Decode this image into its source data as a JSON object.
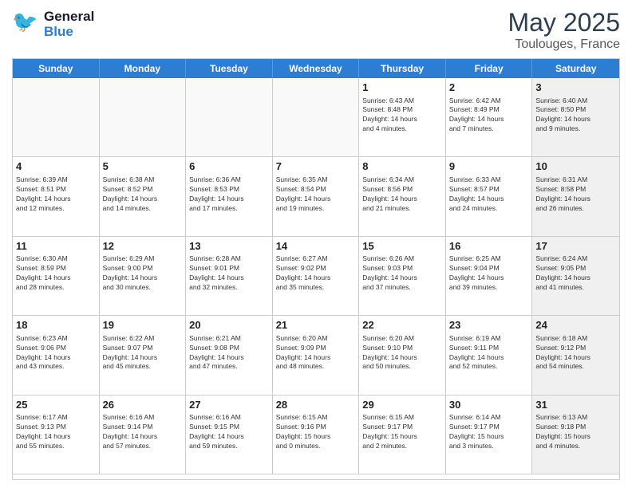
{
  "header": {
    "logo_general": "General",
    "logo_blue": "Blue",
    "month_title": "May 2025",
    "location": "Toulouges, France"
  },
  "day_headers": [
    "Sunday",
    "Monday",
    "Tuesday",
    "Wednesday",
    "Thursday",
    "Friday",
    "Saturday"
  ],
  "cells": [
    {
      "day": "",
      "empty": true
    },
    {
      "day": "",
      "empty": true
    },
    {
      "day": "",
      "empty": true
    },
    {
      "day": "",
      "empty": true
    },
    {
      "day": "1",
      "info": "Sunrise: 6:43 AM\nSunset: 8:48 PM\nDaylight: 14 hours\nand 4 minutes."
    },
    {
      "day": "2",
      "info": "Sunrise: 6:42 AM\nSunset: 8:49 PM\nDaylight: 14 hours\nand 7 minutes."
    },
    {
      "day": "3",
      "info": "Sunrise: 6:40 AM\nSunset: 8:50 PM\nDaylight: 14 hours\nand 9 minutes.",
      "shaded": true
    },
    {
      "day": "4",
      "info": "Sunrise: 6:39 AM\nSunset: 8:51 PM\nDaylight: 14 hours\nand 12 minutes."
    },
    {
      "day": "5",
      "info": "Sunrise: 6:38 AM\nSunset: 8:52 PM\nDaylight: 14 hours\nand 14 minutes."
    },
    {
      "day": "6",
      "info": "Sunrise: 6:36 AM\nSunset: 8:53 PM\nDaylight: 14 hours\nand 17 minutes."
    },
    {
      "day": "7",
      "info": "Sunrise: 6:35 AM\nSunset: 8:54 PM\nDaylight: 14 hours\nand 19 minutes."
    },
    {
      "day": "8",
      "info": "Sunrise: 6:34 AM\nSunset: 8:56 PM\nDaylight: 14 hours\nand 21 minutes."
    },
    {
      "day": "9",
      "info": "Sunrise: 6:33 AM\nSunset: 8:57 PM\nDaylight: 14 hours\nand 24 minutes."
    },
    {
      "day": "10",
      "info": "Sunrise: 6:31 AM\nSunset: 8:58 PM\nDaylight: 14 hours\nand 26 minutes.",
      "shaded": true
    },
    {
      "day": "11",
      "info": "Sunrise: 6:30 AM\nSunset: 8:59 PM\nDaylight: 14 hours\nand 28 minutes."
    },
    {
      "day": "12",
      "info": "Sunrise: 6:29 AM\nSunset: 9:00 PM\nDaylight: 14 hours\nand 30 minutes."
    },
    {
      "day": "13",
      "info": "Sunrise: 6:28 AM\nSunset: 9:01 PM\nDaylight: 14 hours\nand 32 minutes."
    },
    {
      "day": "14",
      "info": "Sunrise: 6:27 AM\nSunset: 9:02 PM\nDaylight: 14 hours\nand 35 minutes."
    },
    {
      "day": "15",
      "info": "Sunrise: 6:26 AM\nSunset: 9:03 PM\nDaylight: 14 hours\nand 37 minutes."
    },
    {
      "day": "16",
      "info": "Sunrise: 6:25 AM\nSunset: 9:04 PM\nDaylight: 14 hours\nand 39 minutes."
    },
    {
      "day": "17",
      "info": "Sunrise: 6:24 AM\nSunset: 9:05 PM\nDaylight: 14 hours\nand 41 minutes.",
      "shaded": true
    },
    {
      "day": "18",
      "info": "Sunrise: 6:23 AM\nSunset: 9:06 PM\nDaylight: 14 hours\nand 43 minutes."
    },
    {
      "day": "19",
      "info": "Sunrise: 6:22 AM\nSunset: 9:07 PM\nDaylight: 14 hours\nand 45 minutes."
    },
    {
      "day": "20",
      "info": "Sunrise: 6:21 AM\nSunset: 9:08 PM\nDaylight: 14 hours\nand 47 minutes."
    },
    {
      "day": "21",
      "info": "Sunrise: 6:20 AM\nSunset: 9:09 PM\nDaylight: 14 hours\nand 48 minutes."
    },
    {
      "day": "22",
      "info": "Sunrise: 6:20 AM\nSunset: 9:10 PM\nDaylight: 14 hours\nand 50 minutes."
    },
    {
      "day": "23",
      "info": "Sunrise: 6:19 AM\nSunset: 9:11 PM\nDaylight: 14 hours\nand 52 minutes."
    },
    {
      "day": "24",
      "info": "Sunrise: 6:18 AM\nSunset: 9:12 PM\nDaylight: 14 hours\nand 54 minutes.",
      "shaded": true
    },
    {
      "day": "25",
      "info": "Sunrise: 6:17 AM\nSunset: 9:13 PM\nDaylight: 14 hours\nand 55 minutes."
    },
    {
      "day": "26",
      "info": "Sunrise: 6:16 AM\nSunset: 9:14 PM\nDaylight: 14 hours\nand 57 minutes."
    },
    {
      "day": "27",
      "info": "Sunrise: 6:16 AM\nSunset: 9:15 PM\nDaylight: 14 hours\nand 59 minutes."
    },
    {
      "day": "28",
      "info": "Sunrise: 6:15 AM\nSunset: 9:16 PM\nDaylight: 15 hours\nand 0 minutes."
    },
    {
      "day": "29",
      "info": "Sunrise: 6:15 AM\nSunset: 9:17 PM\nDaylight: 15 hours\nand 2 minutes."
    },
    {
      "day": "30",
      "info": "Sunrise: 6:14 AM\nSunset: 9:17 PM\nDaylight: 15 hours\nand 3 minutes."
    },
    {
      "day": "31",
      "info": "Sunrise: 6:13 AM\nSunset: 9:18 PM\nDaylight: 15 hours\nand 4 minutes.",
      "shaded": true
    }
  ]
}
